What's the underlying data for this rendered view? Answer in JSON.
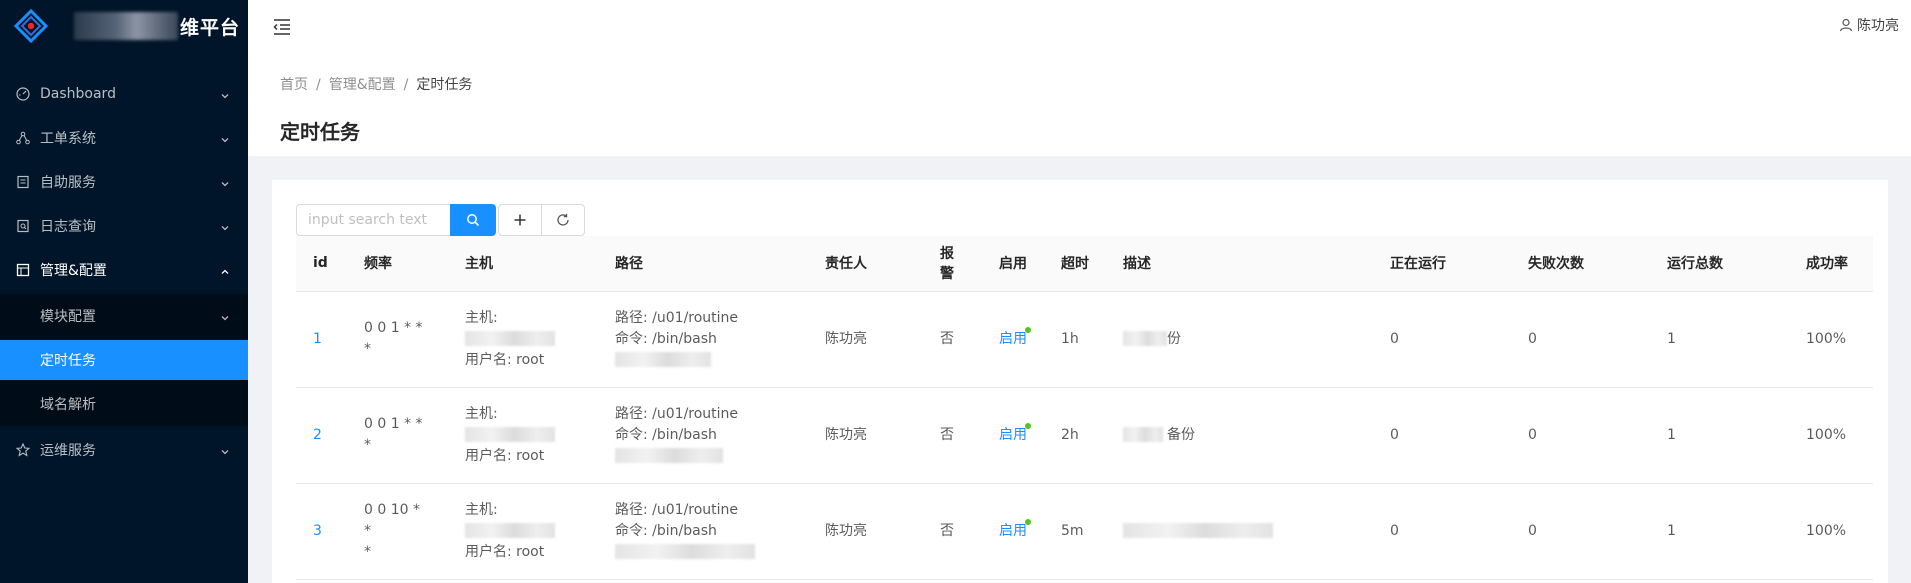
{
  "app": {
    "title_suffix": "维平台",
    "accent": "#1890ff",
    "sider_bg": "#001529"
  },
  "sidebar": {
    "items": [
      {
        "label": "Dashboard",
        "icon": "dashboard-icon"
      },
      {
        "label": "工单系统",
        "icon": "branch-icon"
      },
      {
        "label": "自助服务",
        "icon": "form-icon"
      },
      {
        "label": "日志查询",
        "icon": "file-search-icon"
      },
      {
        "label": "管理&配置",
        "icon": "layout-icon",
        "open": true
      },
      {
        "label": "运维服务",
        "icon": "star-icon"
      }
    ],
    "sub_items": [
      {
        "label": "模块配置"
      },
      {
        "label": "定时任务",
        "selected": true
      },
      {
        "label": "域名解析"
      }
    ]
  },
  "header": {
    "user": "陈功亮"
  },
  "breadcrumb": [
    "首页",
    "管理&配置",
    "定时任务"
  ],
  "page_title": "定时任务",
  "toolbar": {
    "search_placeholder": "input search text"
  },
  "table": {
    "columns": [
      "id",
      "频率",
      "主机",
      "路径",
      "责任人",
      "报警",
      "启用",
      "超时",
      "描述",
      "正在运行",
      "失败次数",
      "运行总数",
      "成功率"
    ],
    "rows": [
      {
        "id": "1",
        "freq_line1": "0 0 1 * * *",
        "freq_line2": "",
        "host_label": "主机:",
        "user_label": "用户名: root",
        "path": "路径: /u01/routine",
        "cmd": "命令: /bin/bash",
        "owner": "陈功亮",
        "alarm": "否",
        "enabled": "启用",
        "timeout": "1h",
        "desc": "份",
        "running": "0",
        "failed": "0",
        "total": "1",
        "rate": "100%"
      },
      {
        "id": "2",
        "freq_line1": "0 0 1 * * *",
        "freq_line2": "",
        "host_label": "主机:",
        "user_label": "用户名: root",
        "path": "路径: /u01/routine",
        "cmd": "命令: /bin/bash",
        "owner": "陈功亮",
        "alarm": "否",
        "enabled": "启用",
        "timeout": "2h",
        "desc": "备份",
        "running": "0",
        "failed": "0",
        "total": "1",
        "rate": "100%"
      },
      {
        "id": "3",
        "freq_line1": "0 0 10 * *",
        "freq_line2": "*",
        "host_label": "主机:",
        "user_label": "用户名: root",
        "path": "路径: /u01/routine",
        "cmd": "命令: /bin/bash",
        "owner": "陈功亮",
        "alarm": "否",
        "enabled": "启用",
        "timeout": "5m",
        "desc": "",
        "running": "0",
        "failed": "0",
        "total": "1",
        "rate": "100%"
      }
    ]
  }
}
